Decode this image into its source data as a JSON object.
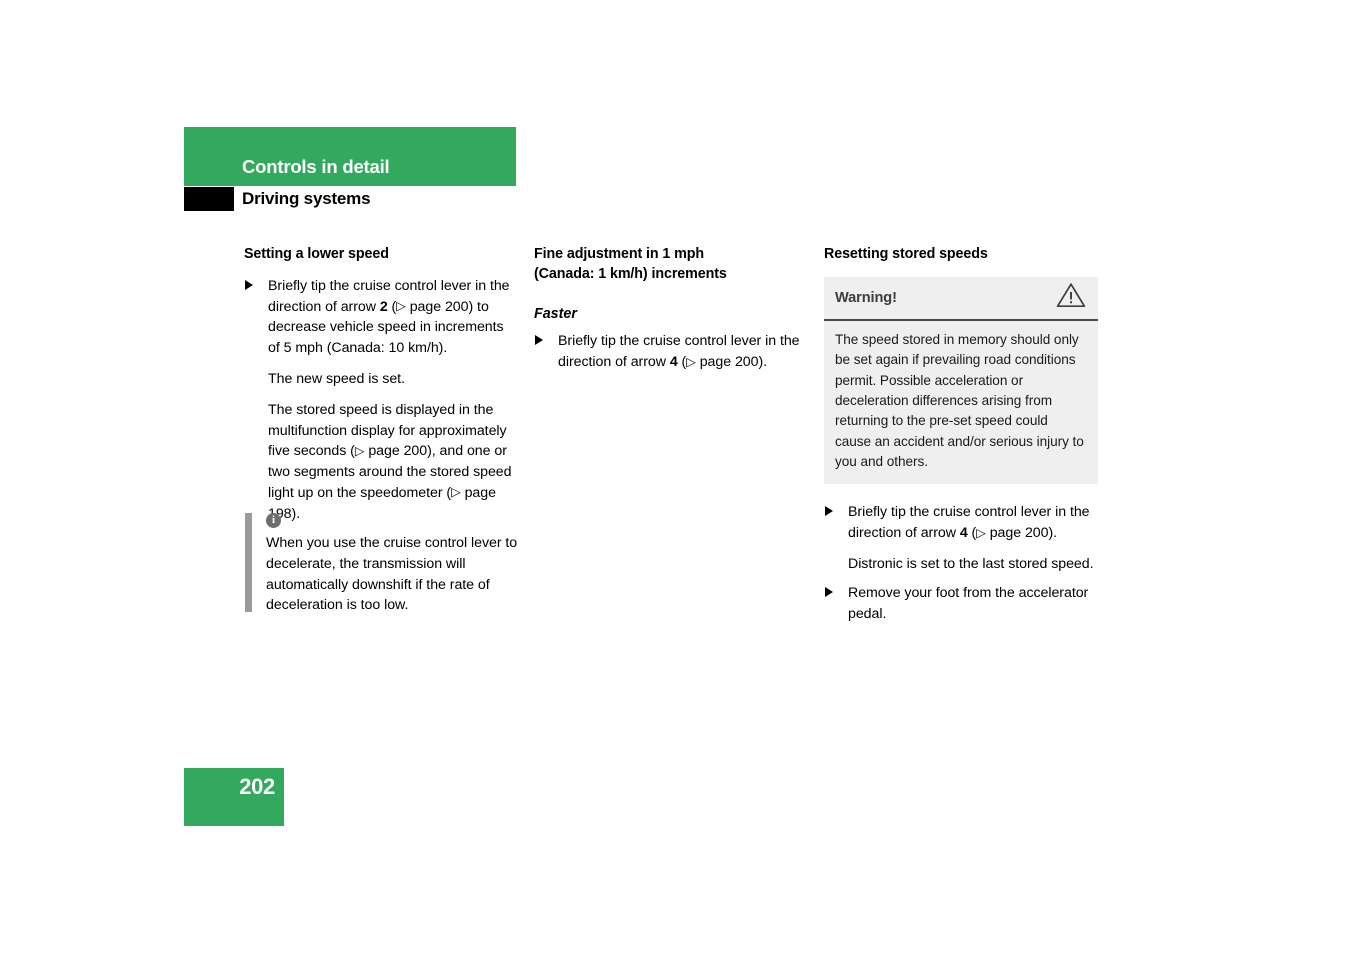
{
  "header": {
    "chapter_title": "Controls in detail",
    "section_title": "Driving systems",
    "green": "#33a95e",
    "tab_color": "#000000"
  },
  "columns": {
    "col1": {
      "heading": "Setting a lower speed",
      "step1": {
        "text_a": "Briefly tip the cruise control lever in the direction of arrow ",
        "arrow_number": "2",
        "text_b": " (",
        "ref_arrow": "▷",
        "ref_page": " page 200",
        "text_c": ") to decrease vehicle speed in increments of 5 mph (Canada: 10 km/h)."
      },
      "para1": "The new speed is set.",
      "para2": {
        "text_a": "The stored speed is displayed in the multifunction display for approximately five seconds (",
        "ref_arrow": "▷",
        "ref_page": " page 200",
        "text_b": "), and one or two segments around the stored speed light up on the speedometer (",
        "ref_arrow2": "▷",
        "ref_page2": " page 198",
        "text_c": ")."
      },
      "note": {
        "icon": "info-icon",
        "icon_glyph": "i",
        "text": "When you use the cruise control lever to decelerate, the transmission will automatically downshift if the rate of deceleration is too low.",
        "bar_color": "#9a9a9a"
      }
    },
    "col2": {
      "heading_line1": "Fine adjustment in 1 mph",
      "heading_line2": "(Canada: 1 km/h) increments",
      "subheading": "Faster",
      "step1": {
        "text_a": "Briefly tip the cruise control lever in the direction of arrow ",
        "arrow_number": "4",
        "text_b": " (",
        "ref_arrow": "▷",
        "ref_page": " page 200",
        "text_c": ")."
      }
    },
    "col3": {
      "heading": "Resetting stored speeds",
      "warning": {
        "label": "Warning!",
        "icon": "warning-triangle-icon",
        "text": "The speed stored in memory should only be set again if prevailing road conditions permit. Possible acceleration or deceleration differences arising from returning to the pre-set speed could cause an accident and/or serious injury to you and others.",
        "background": "#efefef",
        "divider_color": "#4a4a4a"
      },
      "step1": {
        "text_a": "Briefly tip the cruise control lever in the direction of arrow ",
        "arrow_number": "4",
        "text_b": " (",
        "ref_arrow": "▷",
        "ref_page": " page 200",
        "text_c": ")."
      },
      "para1": "Distronic is set to the last stored speed.",
      "step2": {
        "text": "Remove your foot from the accelerator pedal."
      }
    }
  },
  "footer": {
    "page_number": "202"
  }
}
